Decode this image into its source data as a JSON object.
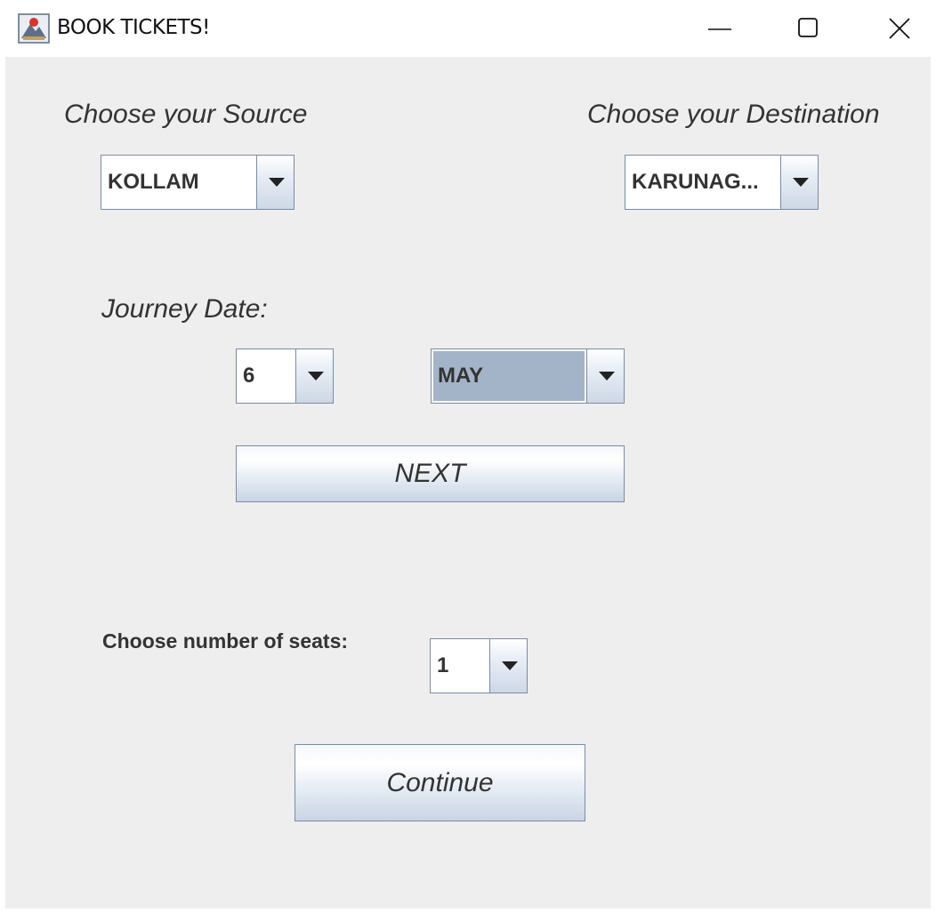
{
  "window": {
    "title": "BOOK TICKETS!",
    "icon": "java-app-icon",
    "controls": [
      "minimize-icon",
      "maximize-icon",
      "close-icon"
    ]
  },
  "source": {
    "label": "Choose your Source",
    "selected": "KOLLAM"
  },
  "destination": {
    "label": "Choose your Destination",
    "selected": "KARUNAG..."
  },
  "journey": {
    "label": "Journey Date:",
    "day": "6",
    "month": "MAY"
  },
  "next_button": "NEXT",
  "seats": {
    "label": "Choose number of seats:",
    "selected": "1"
  },
  "continue_button": "Continue",
  "colors": {
    "background": "#eeeeee",
    "border": "#7a8ca4",
    "selection": "#a3b3c8"
  }
}
